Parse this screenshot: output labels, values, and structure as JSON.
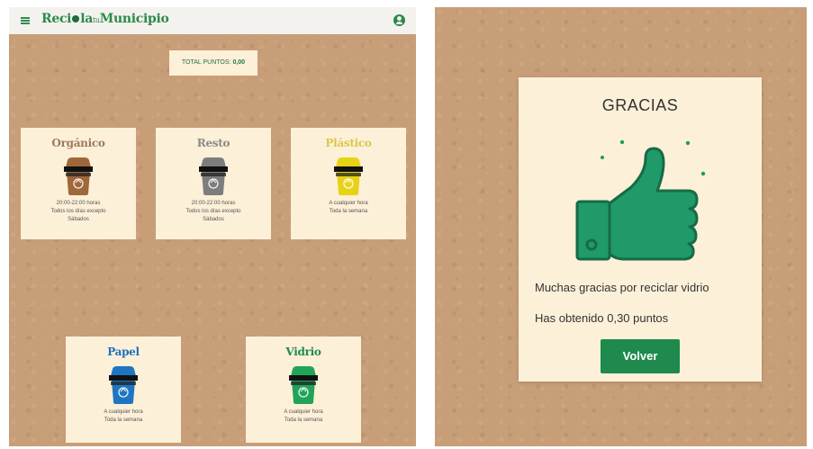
{
  "app": {
    "logo_left": "Reci",
    "logo_mid": "la",
    "logo_tu": "tu",
    "logo_right": "Municipio"
  },
  "points_bar": {
    "label": "TOTAL PUNTOS:",
    "value": "0,00"
  },
  "bins": [
    {
      "title": "Orgánico",
      "color": "#a0673a",
      "title_color": "#9a7a60",
      "line1": "20:00-22:00 horas",
      "line2": "Todos los días excepto",
      "line3": "Sábados"
    },
    {
      "title": "Resto",
      "color": "#7d7d7d",
      "title_color": "#8a8a8a",
      "line1": "20:00-22:00 horas",
      "line2": "Todos los días excepto",
      "line3": "Sábados"
    },
    {
      "title": "Plástico",
      "color": "#e8d215",
      "title_color": "#d9c84a",
      "line1": "A cualquier hora",
      "line2": "Toda la semana",
      "line3": ""
    },
    {
      "title": "Papel",
      "color": "#1e76c2",
      "title_color": "#1e6fbf",
      "line1": "A cualquier hora",
      "line2": "Toda la semana",
      "line3": ""
    },
    {
      "title": "Vidrio",
      "color": "#22a35a",
      "title_color": "#1f8a4e",
      "line1": "A cualquier hora",
      "line2": "Toda la semana",
      "line3": ""
    }
  ],
  "modal": {
    "title": "GRACIAS",
    "message": "Muchas gracias por reciclar vidrio",
    "points_text": "Has obtenido 0,30 puntos",
    "button_label": "Volver",
    "icon": "thumbs-up-icon",
    "accent": "#1f9a68"
  }
}
